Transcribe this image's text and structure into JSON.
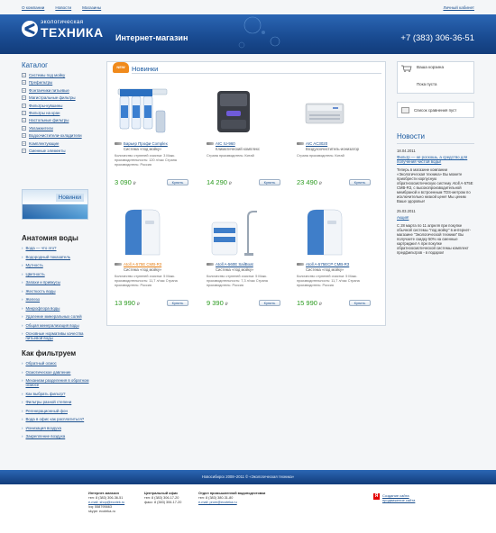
{
  "toplinks": {
    "about": "О компании",
    "news": "Новости",
    "shops": "Магазины",
    "cabinet": "Личный кабинет"
  },
  "header": {
    "logo_sub": "экологическая",
    "logo_main": "ТЕХНИКА",
    "title": "Интернет-магазин",
    "phone": "+7 (383) 306-36-51"
  },
  "catalog": {
    "title": "Каталог",
    "items": [
      "Системы под мойку",
      "Префильтры",
      "Фонтанчики питьевые",
      "Магистральные фильтры",
      "Фильтры-кувшины",
      "Фильтры на кран",
      "Настольные фильтры",
      "Увлажнители",
      "Водоочистители-охладители",
      "Комплектующие",
      "Сменные элементы"
    ]
  },
  "banner": {
    "label": "Новинки"
  },
  "anatomy": {
    "title": "Анатомия воды",
    "items": [
      "Вода — что это?",
      "Водородный показатель",
      "Мутность",
      "Цветность",
      "Запахи и привкусы",
      "Жесткость воды",
      "Железо",
      "Микрофлора воды",
      "Удаление минеральных солей",
      "Общая минерализация воды",
      "Основные нормативы качества питьевой воды"
    ]
  },
  "how": {
    "title": "Как фильтруем",
    "items": [
      "Обратный осмос",
      "Осмотическое давление",
      "Механизм разделения в обратном осмосе",
      "Как выбрать фильтр?",
      "Фильтры разной степени",
      "Регенерационный фон",
      "Вода в офис как расплатиться?",
      "Ионизация воздуха",
      "Закрепление воздуха"
    ]
  },
  "products_section": {
    "badge": "NEW",
    "title": "Новинки"
  },
  "products": [
    {
      "name": "Барьер Профи Complex",
      "sub": "Система «под мойку»",
      "desc": "Количество ступеней очистки: 3 Макс. производительность: 120 л/час Страна производитель: Россия",
      "price": "3 090",
      "currency": "₽",
      "buy": "Купить",
      "highlight": false
    },
    {
      "name": "AIC IU-960",
      "sub": "Климатический комплекс",
      "desc": "Страна производитель: Китай",
      "price": "14 290",
      "currency": "₽",
      "buy": "Купить",
      "highlight": false
    },
    {
      "name": "AIC AC3020",
      "sub": "Воздухоочиститель-ионизатор",
      "desc": "Страна производитель: Китай",
      "price": "23 490",
      "currency": "₽",
      "buy": "Купить",
      "highlight": false
    },
    {
      "name": "Atoll A-575E CMB-R3",
      "sub": "Система «под мойку»",
      "desc": "Количество ступеней очистки: 5 Макс. производительность: 11,7 л/час Страна производитель: Россия",
      "price": "13 990",
      "currency": "₽",
      "buy": "Купить",
      "highlight": true
    },
    {
      "name": "Atoll A-560E SailBoat",
      "sub": "Система «под мойку»",
      "desc": "Количество ступеней очистки: 5 Макс. производительность: 7,3 л/час Страна производитель: Россия",
      "price": "9 390",
      "currency": "₽",
      "buy": "Купить",
      "highlight": false
    },
    {
      "name": "Atoll A-575ECP CMB-R3",
      "sub": "Система «под мойку»",
      "desc": "Количество ступеней очистки: 5 Макс. производительность: 11,7 л/час Страна производитель: Россия",
      "price": "15 990",
      "currency": "₽",
      "buy": "Купить",
      "highlight": false
    }
  ],
  "cart": {
    "title": "Ваша корзина",
    "status": "Пока пуста"
  },
  "compare": {
    "label": "Список сравнения пуст"
  },
  "news": {
    "title": "Новости",
    "items": [
      {
        "date": "18.04.2011",
        "link": "Фильтр — не роскошь, а средство для получения чистой воды!",
        "text": "Теперь в магазине компании «Экологическая техника» Вы можете приобрести корпусную обратноосмотическую систему Atoll A-575E CMB-R3, с высокопроизводительной мембраной и встроенным TDS-метром по исключительно низкой цене! Мы ценим Ваше здоровье!"
      },
      {
        "date": "25.03.2011",
        "link": "Акция!",
        "text": "С 28 марта по 11 апреля при покупке обычной системы \"под мойку\" в интернет-магазине \"Экологической техники\" Вы получаете скидку 50% на сменные картриджи! А при покупке обратноосмотической системы комплект предфильтров - в подарок!"
      }
    ]
  },
  "footer": {
    "bar": "Новосибирск 2008–2011 © «Экологическая техника»",
    "col1": {
      "head": "Интернет-магазин",
      "lines": [
        "тел: 8 (383) 306-36-51",
        "e-mail: shop@ecotek.ru",
        "icq: 558795663",
        "skype: ecoteka-ru"
      ]
    },
    "col2": {
      "head": "Центральный офис",
      "lines": [
        "тел: 8 (383) 306-17-20",
        "факс: 8 (383) 306-17-20"
      ]
    },
    "col3": {
      "head": "Отдел промышленной водоподготовки",
      "lines": [
        "тел: 8 (383) 380-31-80",
        "e-mail: prom@ecoteka.ru"
      ]
    },
    "yandex": {
      "mark": "Я",
      "line1": "Создание сайта",
      "line2": "продвижение сайта"
    }
  }
}
